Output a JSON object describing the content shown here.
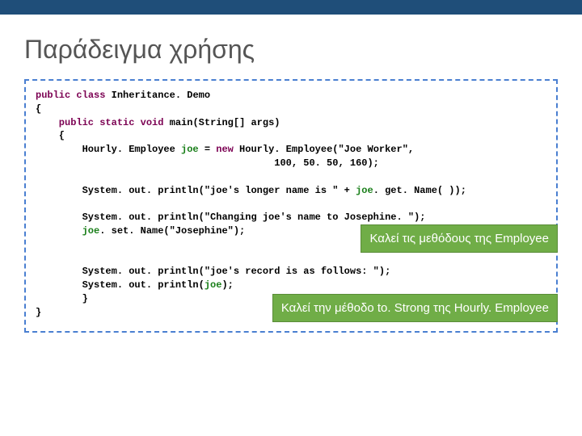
{
  "title": "Παράδειγμα χρήσης",
  "code": {
    "l1a": "public",
    "l1b": " class",
    "l1c": " Inheritance. Demo",
    "l2": "{",
    "l3a": "    public",
    "l3b": " static",
    "l3c": " void",
    "l3d": " main(String[] args)",
    "l4": "    {",
    "l5a": "        Hourly. Employee ",
    "l5b": "joe",
    "l5c": " = ",
    "l5d": "new",
    "l5e": " Hourly. Employee(\"Joe Worker\",",
    "l6": "                                         100, 50. 50, 160);",
    "l7": "",
    "l8a": "        System. out. println(\"joe's longer name is \" + ",
    "l8b": "joe",
    "l8c": ". get. Name( ));",
    "l9": "",
    "l10": "        System. out. println(\"Changing joe's name to Josephine. \");",
    "l11a": "        ",
    "l11b": "joe",
    "l11c": ". set. Name(\"Josephine\");",
    "l12": "",
    "l13": "",
    "l14": "        System. out. println(\"joe's record is as follows: \");",
    "l15a": "        System. out. println(",
    "l15b": "joe",
    "l15c": ");",
    "l16": "        }",
    "l17": "}"
  },
  "callout1": "Καλεί τις μεθόδους της Employee",
  "callout2": "Καλεί την μέθοδο to. Strong της Hourly. Employee"
}
